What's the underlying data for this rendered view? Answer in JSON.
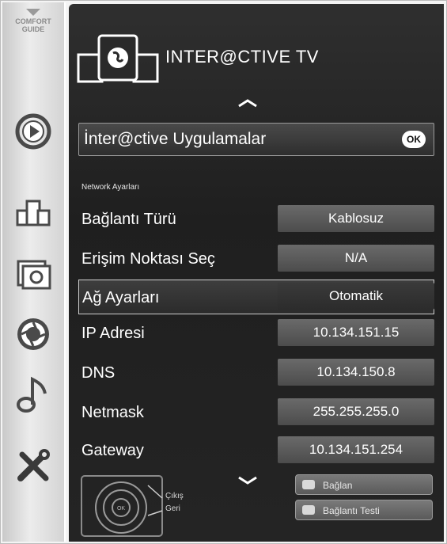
{
  "sidebar": {
    "comfort_line1": "COMFORT",
    "comfort_line2": "GUIDE",
    "items": [
      {
        "icon": "play-circle-icon"
      },
      {
        "icon": "devices-icon"
      },
      {
        "icon": "photo-icon"
      },
      {
        "icon": "aperture-icon"
      },
      {
        "icon": "music-note-icon"
      },
      {
        "icon": "tools-icon"
      }
    ]
  },
  "header": {
    "title": "INTER@CTIVE TV",
    "icon": "globe-tablet-icon"
  },
  "apps": {
    "label": "İnter@ctive Uygulamalar",
    "ok_label": "OK"
  },
  "network": {
    "section_label": "Network Ayarları",
    "rows": [
      {
        "label": "Bağlantı Türü",
        "value": "Kablosuz"
      },
      {
        "label": "Erişim Noktası Seç",
        "value": "N/A"
      },
      {
        "label": "Ağ Ayarları",
        "value": "Otomatik",
        "selected": true
      },
      {
        "label": "IP Adresi",
        "value": "10.134.151.15"
      },
      {
        "label": "DNS",
        "value": "10.134.150.8"
      },
      {
        "label": "Netmask",
        "value": "255.255.255.0"
      },
      {
        "label": "Gateway",
        "value": "10.134.151.254"
      }
    ]
  },
  "footer": {
    "remote_ok": "OK",
    "exit_label": "Çıkış",
    "back_label": "Geri",
    "connect_label": "Bağlan",
    "connection_test_label": "Bağlantı Testi"
  },
  "colors": {
    "panel_bg": "#242424",
    "value_bg": "#5a5a5a",
    "sidebar_bg": "#e0e0e0"
  }
}
